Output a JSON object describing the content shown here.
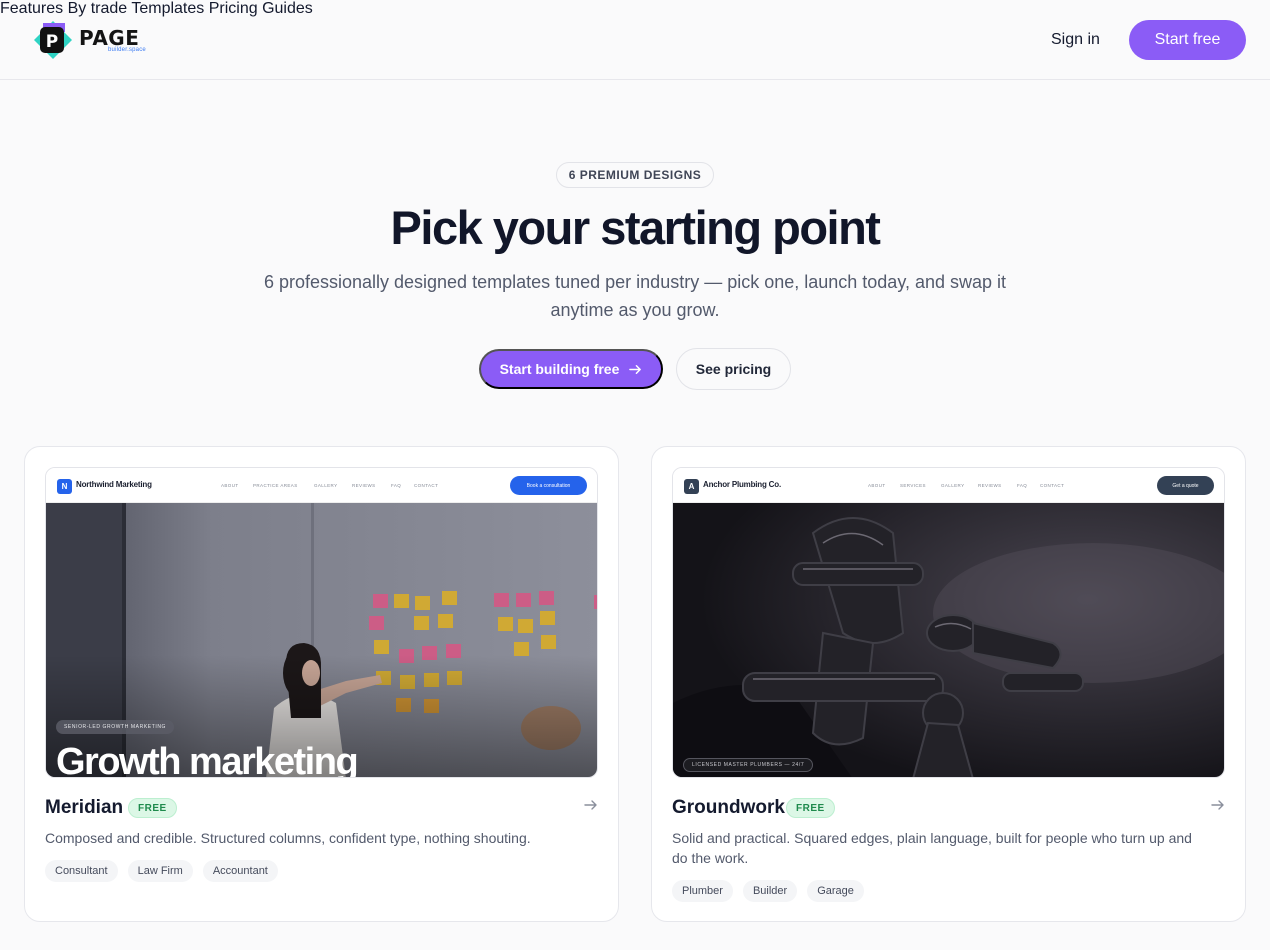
{
  "brand": {
    "name": "PAGE",
    "subtitle": "builder.space",
    "accent": "#8b5cf6"
  },
  "nav": {
    "items": [
      {
        "label": "Features"
      },
      {
        "label": "By trade"
      },
      {
        "label": "Templates"
      },
      {
        "label": "Pricing"
      },
      {
        "label": "Guides"
      }
    ],
    "sign_in": "Sign in",
    "start_free": "Start free"
  },
  "hero": {
    "pill": "6 PREMIUM DESIGNS",
    "title": "Pick your starting point",
    "subtitle": "6 professionally designed templates tuned per industry — pick one, launch today, and swap it anytime as you grow.",
    "primary_cta": "Start building free",
    "secondary_cta": "See pricing"
  },
  "cards": [
    {
      "name": "Meridian",
      "badge": "FREE",
      "description": "Composed and credible. Structured columns, confident type, nothing shouting.",
      "tags": [
        "Consultant",
        "Law Firm",
        "Accountant"
      ],
      "preview": {
        "logo_letter": "N",
        "site_name": "Northwind Marketing",
        "nav": [
          "ABOUT",
          "PRACTICE AREAS",
          "GALLERY",
          "REVIEWS",
          "FAQ",
          "CONTACT"
        ],
        "cta": "Book a consultation",
        "eyebrow": "SENIOR-LED GROWTH MARKETING",
        "headline": "Growth marketing",
        "accent": "#2563eb"
      }
    },
    {
      "name": "Groundwork",
      "badge": "FREE",
      "description": "Solid and practical. Squared edges, plain language, built for people who turn up and do the work.",
      "tags": [
        "Plumber",
        "Builder",
        "Garage"
      ],
      "preview": {
        "logo_letter": "A",
        "site_name": "Anchor Plumbing Co.",
        "nav": [
          "ABOUT",
          "SERVICES",
          "GALLERY",
          "REVIEWS",
          "FAQ",
          "CONTACT"
        ],
        "cta": "Get a quote",
        "eyebrow": "LICENSED MASTER PLUMBERS — 24/7",
        "accent": "#334155"
      }
    }
  ]
}
